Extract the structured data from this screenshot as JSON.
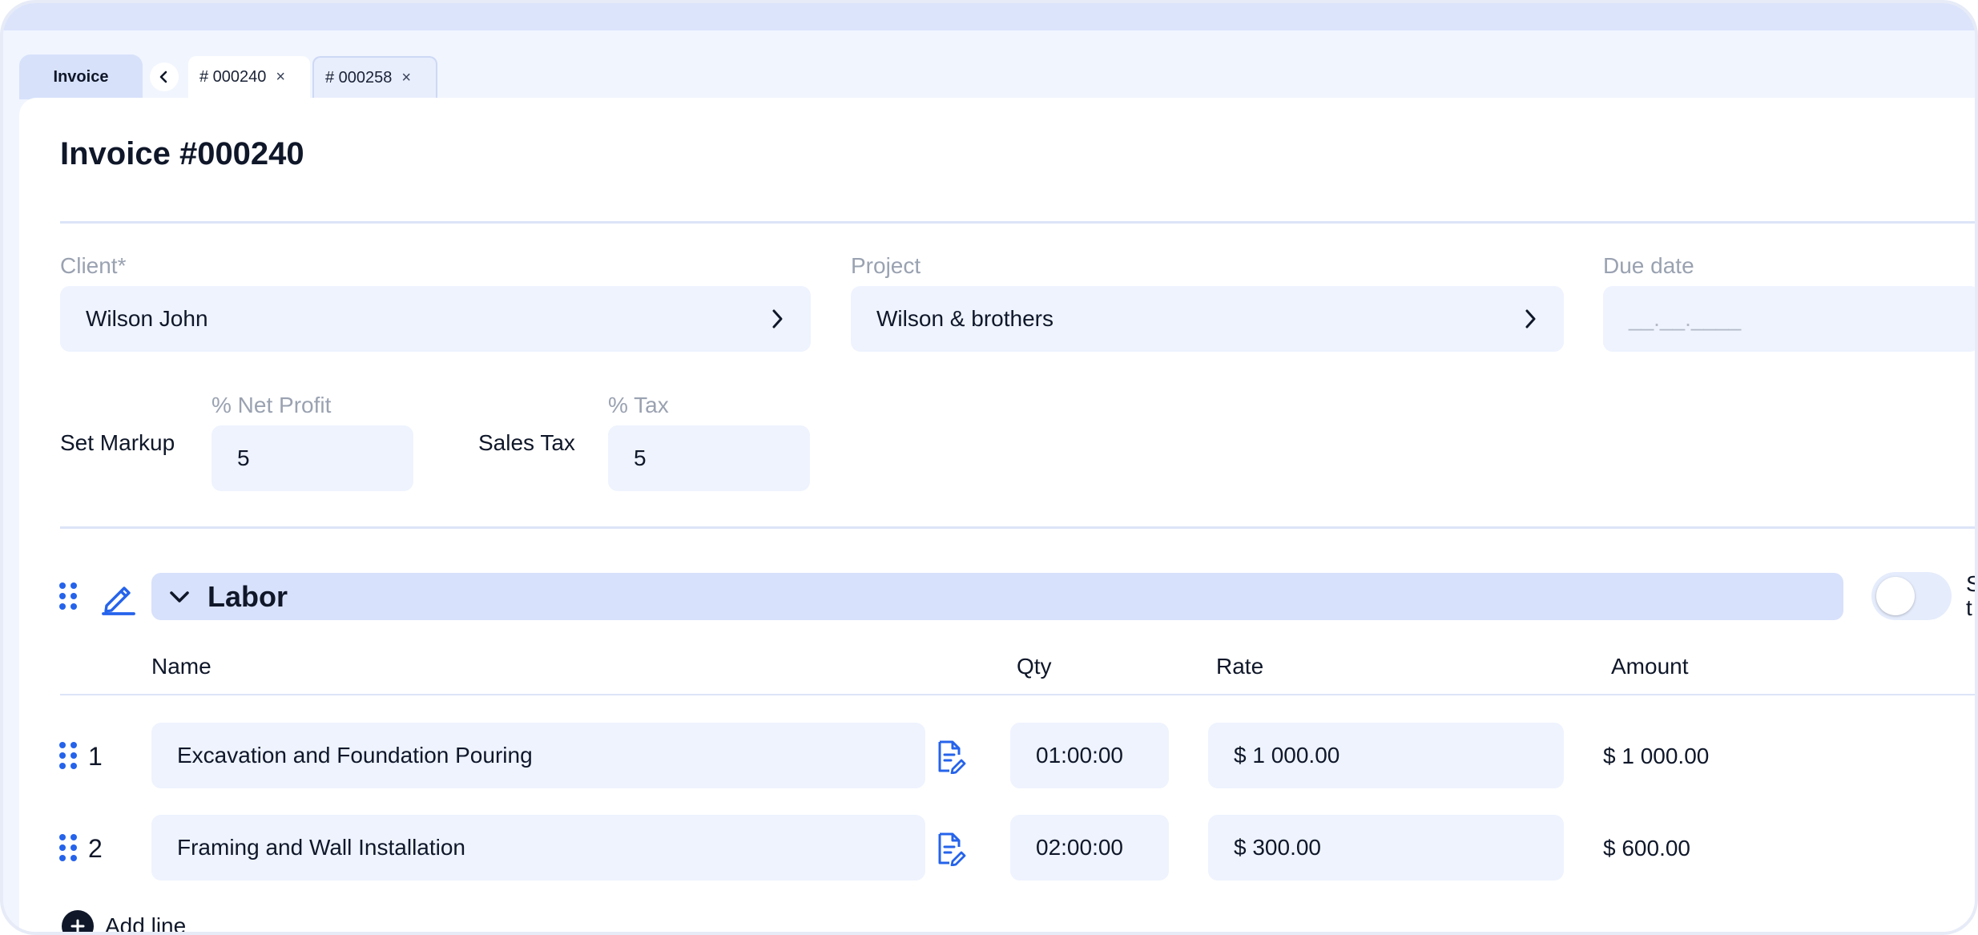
{
  "tabs": {
    "section_label": "Invoice",
    "documents": [
      {
        "label": "# 000240",
        "close": "×"
      },
      {
        "label": "# 000258",
        "close": "×"
      }
    ]
  },
  "page": {
    "title": "Invoice #000240"
  },
  "form": {
    "client": {
      "label": "Client*",
      "value": "Wilson John"
    },
    "project": {
      "label": "Project",
      "value": "Wilson & brothers"
    },
    "due_date": {
      "label": "Due date",
      "placeholder": "__.__.____"
    },
    "markup": {
      "label": "Set Markup",
      "field_label": "% Net Profit",
      "value": "5"
    },
    "sales_tax": {
      "label": "Sales Tax",
      "field_label": "% Tax",
      "value": "5"
    }
  },
  "section": {
    "title": "Labor",
    "toggle_label_line1": "S",
    "toggle_label_line2": "t",
    "toggle_on": false,
    "columns": {
      "name": "Name",
      "qty": "Qty",
      "rate": "Rate",
      "amount": "Amount"
    },
    "rows": [
      {
        "num": "1",
        "name": "Excavation and Foundation Pouring",
        "qty": "01:00:00",
        "rate": "$ 1 000.00",
        "amount": "$ 1 000.00"
      },
      {
        "num": "2",
        "name": "Framing and Wall Installation",
        "qty": "02:00:00",
        "rate": "$ 300.00",
        "amount": "$ 600.00"
      }
    ],
    "add_line": "Add line"
  },
  "colors": {
    "accent": "#2563eb",
    "field_bg": "#eef3fe",
    "section_bg": "#d7e1fb",
    "divider": "#dce4f8"
  },
  "icons": {
    "back": "chevron-left-icon",
    "select": "chevron-right-icon",
    "collapse": "chevron-down-icon",
    "edit": "pencil-icon",
    "drag": "drag-handle-icon",
    "note": "document-edit-icon",
    "add": "plus-circle-icon"
  }
}
